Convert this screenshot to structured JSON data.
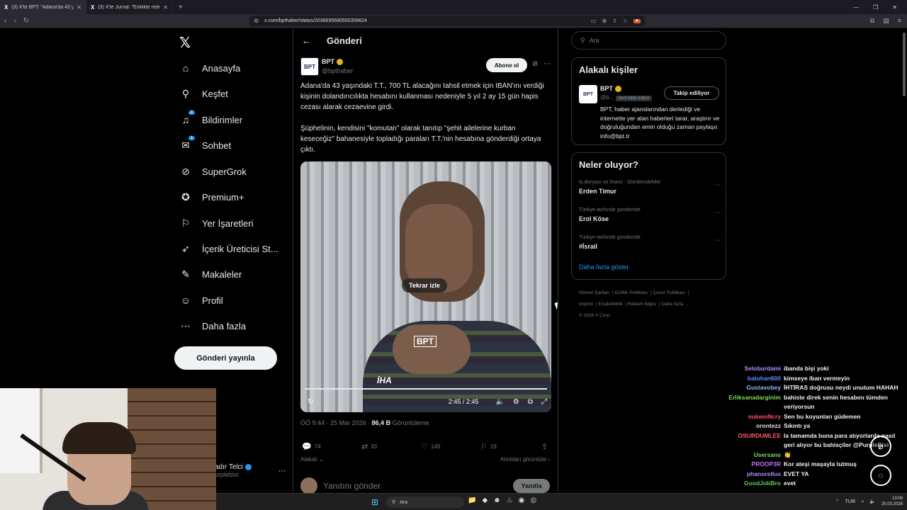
{
  "browser": {
    "tabs": [
      {
        "title": "(3) X'te BPT: \"Adana'da 43 yaşın...",
        "active": true
      },
      {
        "title": "(3) X'te Jurnal: \"Evlilikte reddettiği ev...",
        "active": false
      }
    ],
    "url": "x.com/bpthaber/status/2036695690500358624",
    "new_tab": "+"
  },
  "nav": {
    "brand": "𝕏",
    "items": [
      {
        "label": "Anasayfa",
        "icon": "home-icon",
        "glyph": "⌂"
      },
      {
        "label": "Keşfet",
        "icon": "search-icon",
        "glyph": "⚲"
      },
      {
        "label": "Bildirimler",
        "icon": "bell-icon",
        "glyph": "♫",
        "badge": "2"
      },
      {
        "label": "Sohbet",
        "icon": "mail-icon",
        "glyph": "✉",
        "badge": "1"
      },
      {
        "label": "SuperGrok",
        "icon": "grok-icon",
        "glyph": "⊘"
      },
      {
        "label": "Premium+",
        "icon": "premium-icon",
        "glyph": "✪"
      },
      {
        "label": "Yer İşaretleri",
        "icon": "bookmark-icon",
        "glyph": "⚐"
      },
      {
        "label": "İçerik Üreticisi St...",
        "icon": "rocket-icon",
        "glyph": "➶"
      },
      {
        "label": "Makaleler",
        "icon": "article-icon",
        "glyph": "✎"
      },
      {
        "label": "Profil",
        "icon": "profile-icon",
        "glyph": "☺"
      },
      {
        "label": "Daha fazla",
        "icon": "more-icon",
        "glyph": "⋯"
      }
    ],
    "post_button": "Gönderi yayınla",
    "account_name": "adır Telci",
    "account_handle": "urplebixi"
  },
  "post": {
    "header": "Gönderi",
    "author_name": "BPT",
    "author_handle": "@bpthaber",
    "avatar_text": "BPT",
    "subscribe": "Abone ol",
    "text_1": "Adana'da 43 yaşındaki T.T., 700 TL alacağını tahsil etmek için IBAN'ını verdiği kişinin dolandırıcılıkta hesabını kullanması nedeniyle 5 yıl 2 ay 15 gün hapis cezası alarak cezaevine girdi.",
    "text_2": "Şüphelinin, kendisini \"komutan\" olarak tanıtıp \"şehit ailelerine kurban keseceğiz\" bahanesiyle topladığı paraları T.T.'nin hesabına gönderdiği ortaya çıktı.",
    "video": {
      "replay": "Tekrar izle",
      "time": "2:45 / 2:45",
      "watermark": "BPT",
      "agency": "İHA",
      "progress": 1.0
    },
    "meta_time": "ÖÖ 9:44 · 25 Mar 2026 · ",
    "views": "86,4 B",
    "views_label": " Görüntüleme",
    "stats": {
      "replies": "74",
      "reposts": "33",
      "likes": "149",
      "bookmarks": "19"
    },
    "context_left": "Alakalı",
    "context_right": "Alıntıları görüntüle",
    "reply_placeholder": "Yanıtını gönder",
    "reply_button": "Yanıtla"
  },
  "sidebar": {
    "search_placeholder": "Ara",
    "related_title": "Alakalı kişiler",
    "related_name": "BPT",
    "related_handle": "@b...",
    "follows_you": "Seni takip ediyor",
    "following_button": "Takip ediliyor",
    "related_bio": "BPT, haber ajanslarından derlediği ve internette yer alan haberleri tarar, araştırır ve doğruluğundan emin olduğu zaman paylaşır. info@bpt.tr",
    "trends_title": "Neler oluyor?",
    "trends": [
      {
        "context": "İş dünyası ve finans · Gündemdekiler",
        "name": "Erden Timur"
      },
      {
        "context": "Türkiye tarihinde gündemde",
        "name": "Erol Köse"
      },
      {
        "context": "Türkiye tarihinde gündemde",
        "name": "#İsrail"
      }
    ],
    "show_more": "Daha fazla göster",
    "footer": [
      "Hizmet Şartları",
      "Gizlilik Politikası",
      "Çerez Politikası",
      "Imprint",
      "Erişilebilirlik",
      "Reklam bilgisi",
      "Daha fazla ...",
      "© 2026 X Corp."
    ]
  },
  "chat": [
    {
      "user": "Seloburdami",
      "color": "#b08cff",
      "msg": "ibanda bişi yoki"
    },
    {
      "user": "batuhan600",
      "color": "#5b8cff",
      "msg": "kimseye iban vermeyin"
    },
    {
      "user": "Gustavobey",
      "color": "#8fb8ff",
      "msg": "İHTİRAS doğrusu neydi unutum HAHAH"
    },
    {
      "user": "Erliksanadarginim",
      "color": "#7ddc5b",
      "msg": "bahiste direk senin hesabını tümden veriyorsun"
    },
    {
      "user": "nukemNcry",
      "color": "#ff4f6e",
      "msg": "Sen bu koyunları güdemen"
    },
    {
      "user": "orontezz",
      "color": "#e0e0e0",
      "msg": "Sıkıntı ya"
    },
    {
      "user": "OSURDUMLEE",
      "color": "#ff5c5c",
      "msg": "la tamamda buna para atıyorlarda nasıl geri alıyor bu bahisçiler @PurpleBixi"
    },
    {
      "user": "Usersans",
      "color": "#7ddc5b",
      "msg": "👏"
    },
    {
      "user": "PROOP3R",
      "color": "#c06bff",
      "msg": "Kor ateşi maşayla tutmuş"
    },
    {
      "user": "phanorellux",
      "color": "#b08cff",
      "msg": "EVET YA"
    },
    {
      "user": "GoodJobBro",
      "color": "#57d15a",
      "msg": "evet"
    }
  ],
  "taskbar": {
    "search": "Ara",
    "lang": "TUR",
    "time": "13:06",
    "date": "25.03.2026"
  }
}
